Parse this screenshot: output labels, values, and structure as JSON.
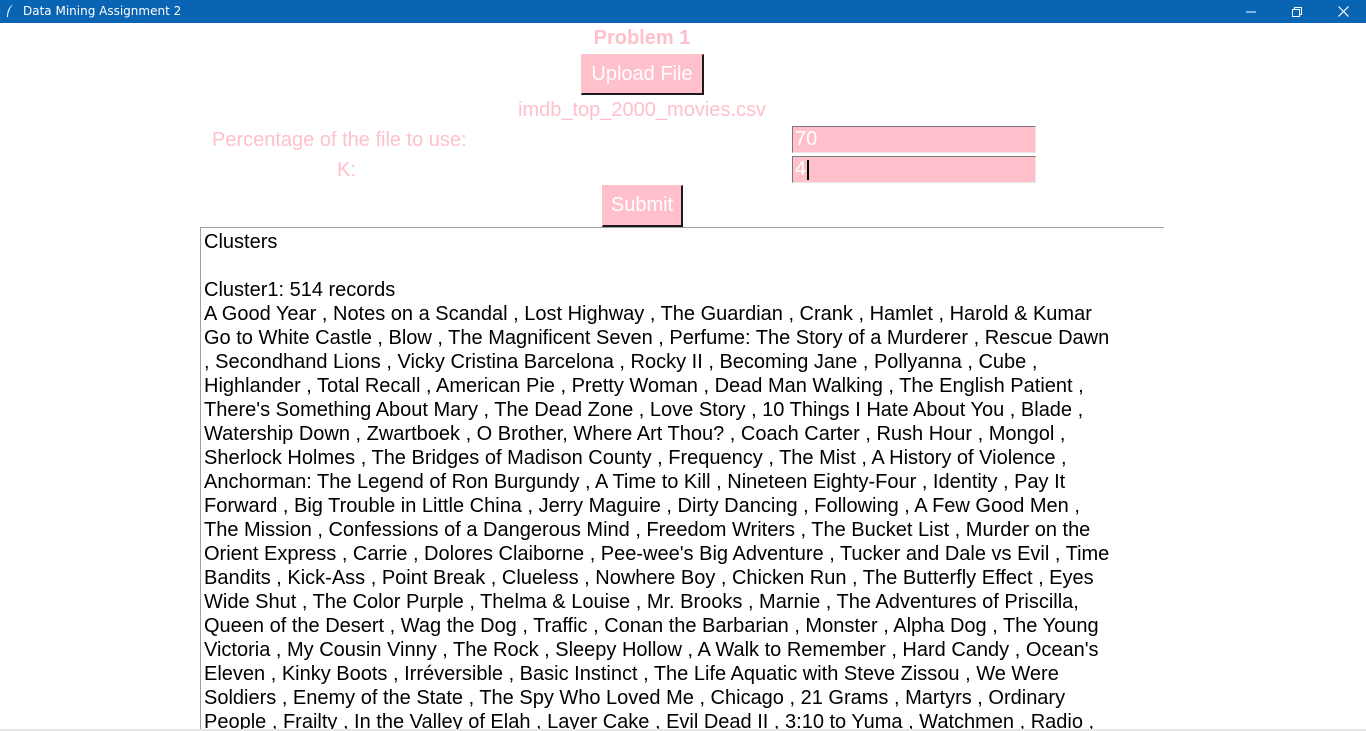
{
  "window": {
    "title": "Data Mining Assignment 2",
    "icon": "feather-icon",
    "controls": {
      "minimize": "minimize-icon",
      "maximize": "restore-icon",
      "close": "close-icon"
    }
  },
  "form": {
    "heading": "Problem 1",
    "upload_label": "Upload File",
    "filename": "imdb_top_2000_movies.csv",
    "percentage_label": "Percentage of the file to use:",
    "percentage_value": "70",
    "k_label": "K:",
    "k_value": "4",
    "submit_label": "Submit"
  },
  "colors": {
    "accent": "#ffc0cb",
    "titlebar": "#0a64b4"
  },
  "output": {
    "lines": [
      "Clusters",
      "",
      "Cluster1: 514 records",
      "A Good Year , Notes on a Scandal , Lost Highway , The Guardian , Crank , Hamlet , Harold & Kumar",
      "Go to White Castle , Blow , The Magnificent Seven , Perfume: The Story of a Murderer , Rescue Dawn",
      ", Secondhand Lions , Vicky Cristina Barcelona , Rocky II , Becoming Jane , Pollyanna , Cube ,",
      "Highlander , Total Recall , American Pie , Pretty Woman , Dead Man Walking , The English Patient ,",
      "There's Something About Mary , The Dead Zone , Love Story , 10 Things I Hate About You , Blade ,",
      "Watership Down , Zwartboek , O Brother, Where Art Thou? , Coach Carter , Rush Hour , Mongol ,",
      "Sherlock Holmes , The Bridges of Madison County , Frequency , The Mist , A History of Violence ,",
      "Anchorman: The Legend of Ron Burgundy , A Time to Kill , Nineteen Eighty-Four , Identity , Pay It",
      "Forward , Big Trouble in Little China , Jerry Maguire , Dirty Dancing , Following , A Few Good Men ,",
      "The Mission , Confessions of a Dangerous Mind , Freedom Writers , The Bucket List , Murder on the",
      "Orient Express , Carrie , Dolores Claiborne , Pee-wee's Big Adventure , Tucker and Dale vs Evil , Time",
      "Bandits , Kick-Ass , Point Break , Clueless , Nowhere Boy , Chicken Run , The Butterfly Effect , Eyes",
      "Wide Shut , The Color Purple , Thelma & Louise , Mr. Brooks , Marnie , The Adventures of Priscilla,",
      "Queen of the Desert , Wag the Dog , Traffic , Conan the Barbarian , Monster , Alpha Dog , The Young",
      "Victoria , My Cousin Vinny , The Rock , Sleepy Hollow , A Walk to Remember , Hard Candy , Ocean's",
      "Eleven , Kinky Boots , Irréversible , Basic Instinct , The Life Aquatic with Steve Zissou , We Were",
      "Soldiers , Enemy of the State , The Spy Who Loved Me , Chicago , 21 Grams , Martyrs , Ordinary",
      "People , Frailty , In the Valley of Elah , Layer Cake , Evil Dead II , 3:10 to Yuma , Watchmen , Radio ,"
    ]
  }
}
